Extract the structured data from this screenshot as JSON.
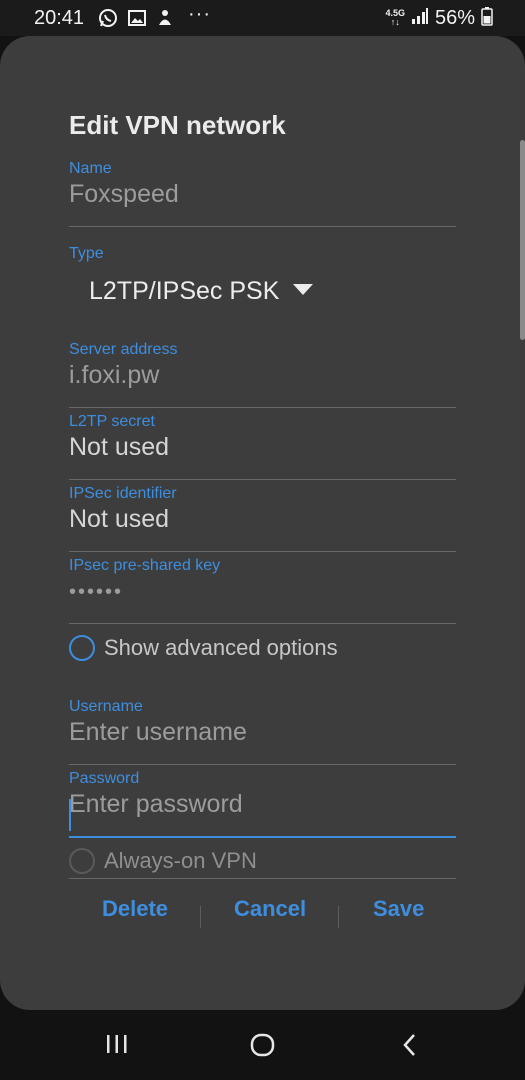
{
  "status_bar": {
    "time": "20:41",
    "network_type_top": "4.5G",
    "network_type_bottom": "↑↓",
    "battery": "56%",
    "more": "···",
    "icons": [
      "whatsapp-icon",
      "image-icon",
      "app-notification-icon",
      "signal-icon",
      "battery-icon"
    ]
  },
  "dialog": {
    "title": "Edit VPN network",
    "fields": {
      "name": {
        "label": "Name",
        "value": "Foxspeed"
      },
      "type": {
        "label": "Type",
        "value": "L2TP/IPSec PSK"
      },
      "server_address": {
        "label": "Server address",
        "value": "i.foxi.pw"
      },
      "l2tp_secret": {
        "label": "L2TP secret",
        "value": "Not used"
      },
      "ipsec_identifier": {
        "label": "IPSec identifier",
        "value": "Not used"
      },
      "ipsec_psk": {
        "label": "IPsec pre-shared key",
        "value": "••••••"
      },
      "username": {
        "label": "Username",
        "placeholder": "Enter username"
      },
      "password": {
        "label": "Password",
        "placeholder": "Enter password"
      }
    },
    "show_advanced_label": "Show advanced options",
    "always_on_label": "Always-on VPN",
    "buttons": {
      "delete": "Delete",
      "cancel": "Cancel",
      "save": "Save"
    }
  },
  "colors": {
    "accent": "#3e8ee0",
    "dialog_bg": "#3d3d3d",
    "screen_bg": "#121212"
  }
}
